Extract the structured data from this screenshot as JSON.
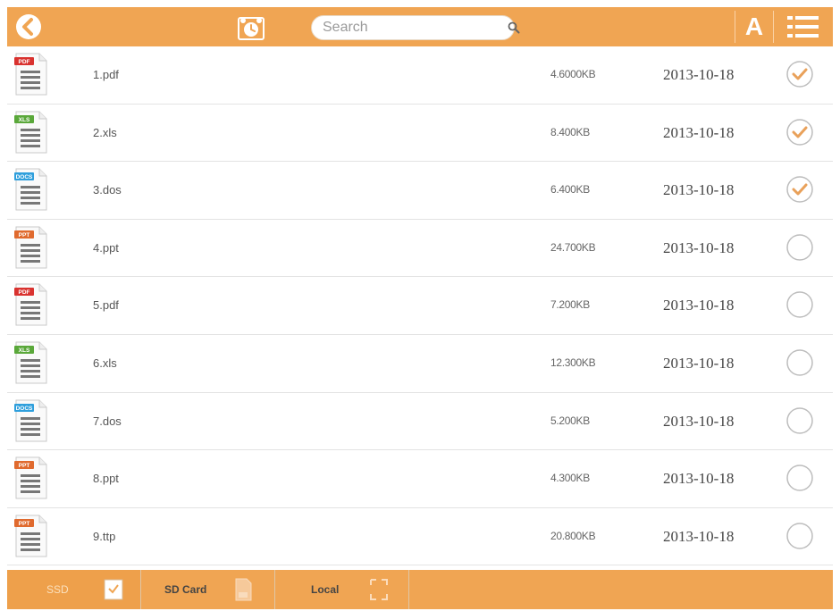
{
  "colors": {
    "accent": "#f0a553",
    "pdf": "#d9322f",
    "xls": "#5aa83a",
    "docs": "#2f9fdc",
    "ppt": "#e06a2e",
    "check": "#e9a15a"
  },
  "header": {
    "back_icon": "back-arrow-icon",
    "clock_icon": "alarm-clock-icon",
    "search_placeholder": "Search",
    "sort_label": "A",
    "list_icon": "list-view-icon"
  },
  "files": [
    {
      "badge": "PDF",
      "type": "pdf",
      "name": "1.pdf",
      "size": "4.6000KB",
      "date": "2013-10-18",
      "checked": true
    },
    {
      "badge": "XLS",
      "type": "xls",
      "name": "2.xls",
      "size": "8.400KB",
      "date": "2013-10-18",
      "checked": true
    },
    {
      "badge": "DOCS",
      "type": "docs",
      "name": "3.dos",
      "size": "6.400KB",
      "date": "2013-10-18",
      "checked": true
    },
    {
      "badge": "PPT",
      "type": "ppt",
      "name": "4.ppt",
      "size": "24.700KB",
      "date": "2013-10-18",
      "checked": false
    },
    {
      "badge": "PDF",
      "type": "pdf",
      "name": "5.pdf",
      "size": "7.200KB",
      "date": "2013-10-18",
      "checked": false
    },
    {
      "badge": "XLS",
      "type": "xls",
      "name": "6.xls",
      "size": "12.300KB",
      "date": "2013-10-18",
      "checked": false
    },
    {
      "badge": "DOCS",
      "type": "docs",
      "name": "7.dos",
      "size": "5.200KB",
      "date": "2013-10-18",
      "checked": false
    },
    {
      "badge": "PPT",
      "type": "ppt",
      "name": "8.ppt",
      "size": "4.300KB",
      "date": "2013-10-18",
      "checked": false
    },
    {
      "badge": "PPT",
      "type": "ppt",
      "name": "9.ttp",
      "size": "20.800KB",
      "date": "2013-10-18",
      "checked": false
    }
  ],
  "tabs": [
    {
      "label": "SSD",
      "icon": "ssd-icon",
      "active": true
    },
    {
      "label": "SD Card",
      "icon": "sd-card-icon",
      "active": false
    },
    {
      "label": "Local",
      "icon": "local-icon",
      "active": false
    }
  ]
}
